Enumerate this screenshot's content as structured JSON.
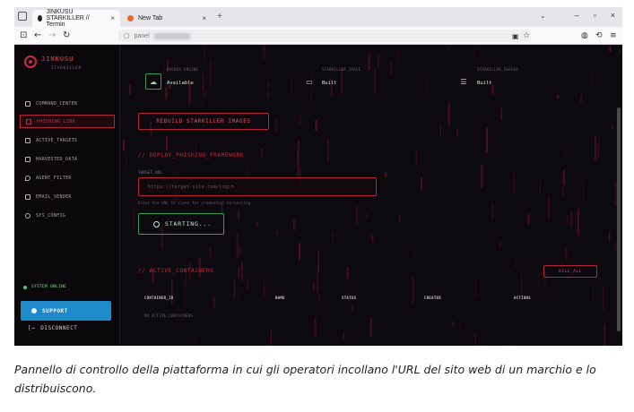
{
  "browser": {
    "tabs": [
      {
        "label": "JINKUSU STARKILLER // Termin"
      },
      {
        "label": "New Tab"
      }
    ],
    "url": "panel"
  },
  "app": {
    "brand": {
      "title": "JINKUSU",
      "subtitle": "STARKILLER"
    },
    "nav": [
      {
        "label": "COMMAND_CENTER",
        "icon": "grid-icon"
      },
      {
        "label": "PHISHING_LINK",
        "icon": "link-icon",
        "active": true
      },
      {
        "label": "ACTIVE_TARGETS",
        "icon": "users-icon"
      },
      {
        "label": "HARVESTED_DATA",
        "icon": "file-icon"
      },
      {
        "label": "AGENT_FILTER",
        "icon": "shield-icon"
      },
      {
        "label": "EMAIL_SENDER",
        "icon": "mail-icon"
      },
      {
        "label": "SYS_CONFIG",
        "icon": "gear-icon"
      }
    ],
    "system_status": "SYSTEM ONLINE",
    "support_label": "SUPPORT",
    "disconnect_label": "DISCONNECT",
    "stats": [
      {
        "label": "DOCKER_ENGINE",
        "value": "Available",
        "icon": "cloud-icon"
      },
      {
        "label": "STARKILLER_IMAGE",
        "value": "Built",
        "icon": "monitor-icon"
      },
      {
        "label": "STARKILLER_SERVER",
        "value": "Built",
        "icon": "server-icon"
      }
    ],
    "rebuild_label": "REBUILD STARKILLER IMAGES",
    "deploy": {
      "title": "// DEPLOY_PHISHING_FRAMEWORK",
      "target_label": "TARGET_URL",
      "target_placeholder": "https://target-site.com/login",
      "hint": "Enter the URL to clone for credential harvesting",
      "start_label": "STARTING..."
    },
    "containers": {
      "title": "// ACTIVE_CONTAINERS",
      "kill_all_label": "KILL_ALL",
      "columns": [
        "CONTAINER_ID",
        "NAME",
        "STATUS",
        "CREATED",
        "ACTIONS"
      ],
      "empty_text": "NO_ACTIVE_CONTAINERS"
    }
  },
  "caption": "Pannello di controllo della piattaforma in cui gli operatori incollano l'URL del sito web di un marchio e lo distribuiscono.",
  "colors": {
    "accent": "#c62a45",
    "success": "#2f9e57",
    "support": "#1e8ac9",
    "background": "#0c0a0e"
  }
}
